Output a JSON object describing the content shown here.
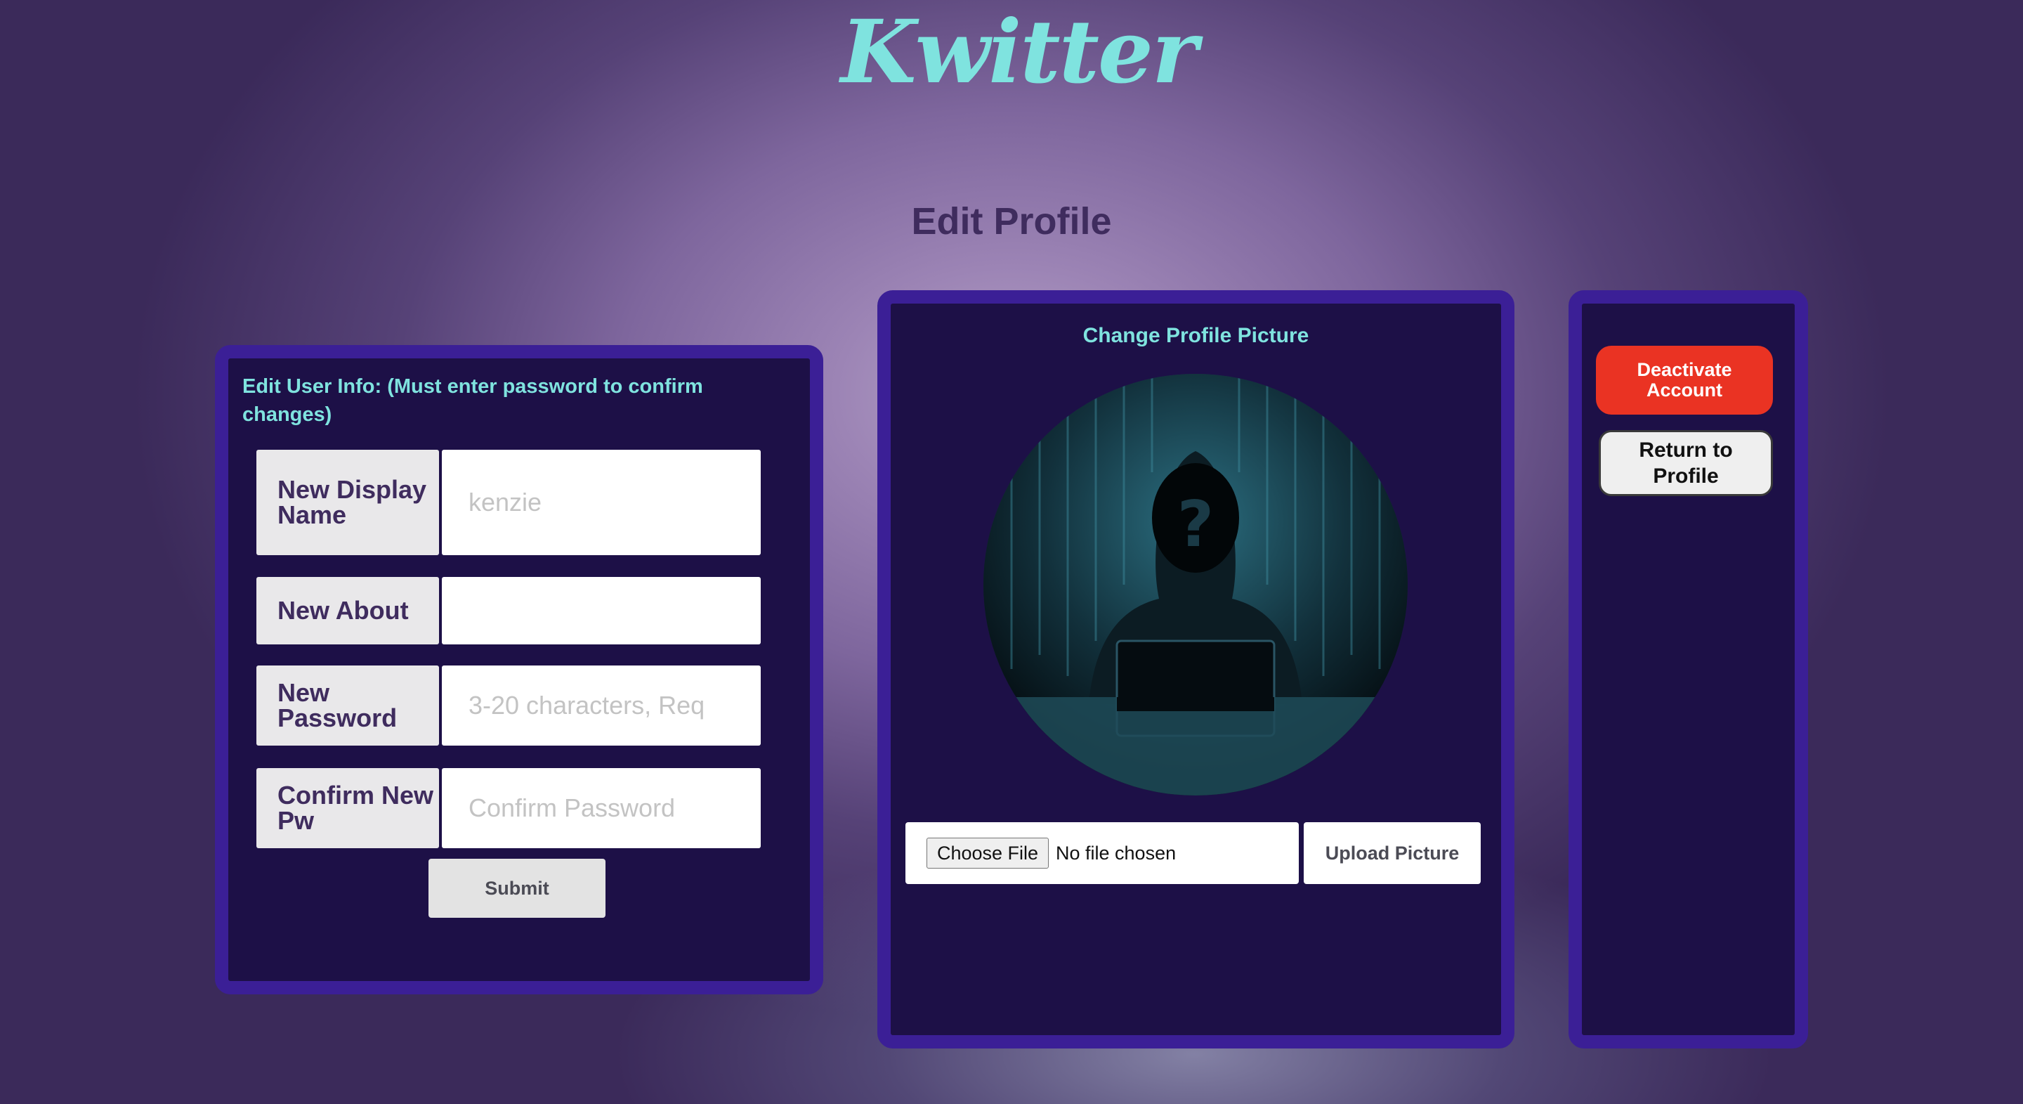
{
  "header": {
    "logo_text": "Kwitter",
    "page_title": "Edit Profile"
  },
  "edit_info": {
    "heading": "Edit User Info: (Must enter password to confirm changes)",
    "fields": [
      {
        "label": "New Display Name",
        "value": "",
        "placeholder": "kenzie"
      },
      {
        "label": "New About",
        "value": "",
        "placeholder": ""
      },
      {
        "label": "New Password",
        "value": "",
        "placeholder": "3-20 characters, Req"
      },
      {
        "label": "Confirm New Pw",
        "value": "",
        "placeholder": "Confirm Password"
      }
    ],
    "submit_label": "Submit"
  },
  "profile_picture": {
    "heading": "Change Profile Picture",
    "avatar_icon": "hooded-hacker-icon",
    "choose_file_label": "Choose File",
    "file_status": "No file chosen",
    "upload_label": "Upload Picture"
  },
  "account_actions": {
    "deactivate_label": "Deactivate Account",
    "return_label": "Return to Profile"
  },
  "colors": {
    "accent_teal": "#7fe3df",
    "panel_bg": "#1d1047",
    "panel_border": "#3b1f96",
    "title_purple": "#3f2c5e",
    "danger_red": "#ea3323"
  }
}
